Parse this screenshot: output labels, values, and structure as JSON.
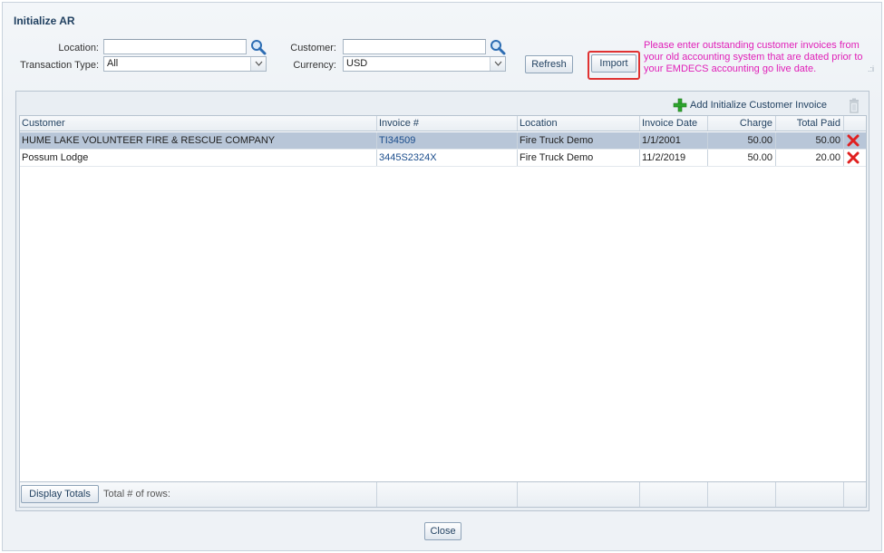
{
  "dialog": {
    "title": "Initialize AR"
  },
  "filters": {
    "location_label": "Location:",
    "location_value": "",
    "customer_label": "Customer:",
    "customer_value": "",
    "transaction_type_label": "Transaction Type:",
    "transaction_type_value": "All",
    "currency_label": "Currency:",
    "currency_value": "USD"
  },
  "actions": {
    "refresh_label": "Refresh",
    "import_label": "Import",
    "import_message": "Please enter outstanding customer invoices from your old accounting system that are dated prior to your EMDECS accounting go live date."
  },
  "toolbar": {
    "add_label": "Add Initialize Customer Invoice",
    "add_icon": "plus-icon",
    "delete_icon": "trash-icon"
  },
  "table": {
    "columns": {
      "customer": "Customer",
      "invoice": "Invoice #",
      "location": "Location",
      "invoice_date": "Invoice Date",
      "charge": "Charge",
      "total_paid": "Total Paid"
    },
    "rows": [
      {
        "customer": "HUME LAKE VOLUNTEER FIRE & RESCUE COMPANY",
        "invoice": "TI34509",
        "location": "Fire Truck Demo",
        "invoice_date": "1/1/2001",
        "charge": "50.00",
        "total_paid": "50.00"
      },
      {
        "customer": "Possum Lodge",
        "invoice": "3445S2324X",
        "location": "Fire Truck Demo",
        "invoice_date": "11/2/2019",
        "charge": "50.00",
        "total_paid": "20.00"
      }
    ],
    "display_totals_label": "Display Totals",
    "total_rows_label": "Total # of rows:"
  },
  "footer": {
    "close_label": "Close"
  },
  "colors": {
    "accent": "#1f3f5f",
    "message": "#e020b8",
    "highlight": "#e03232",
    "selected_row": "#b8c6d8"
  }
}
